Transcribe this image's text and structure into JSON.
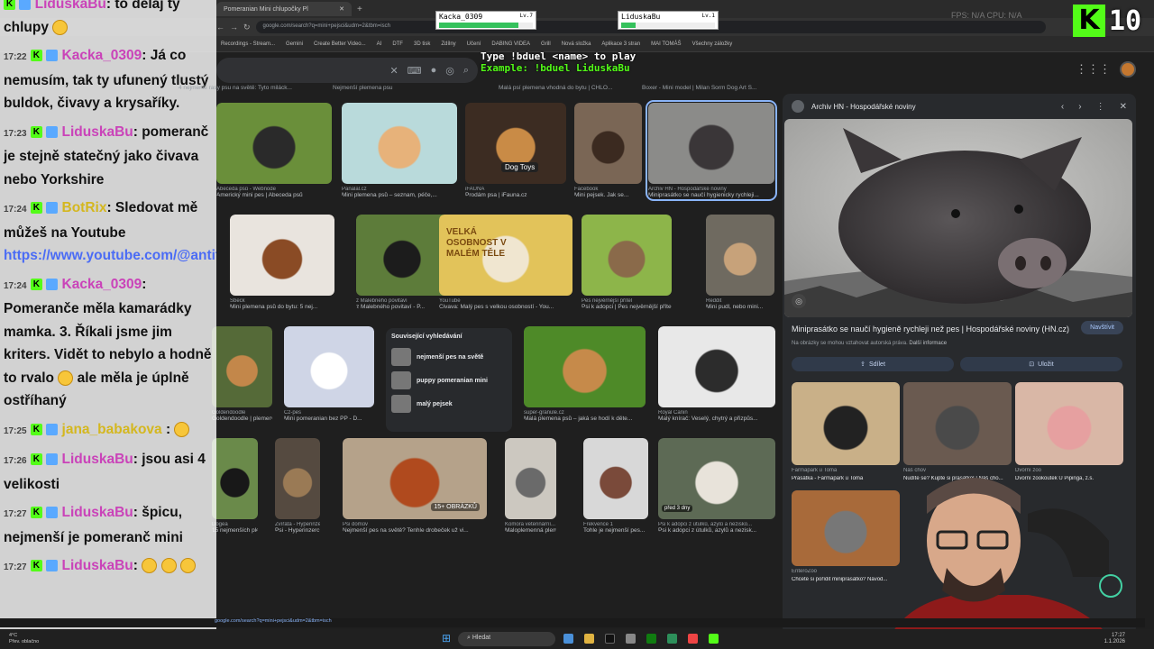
{
  "browser": {
    "tab_title": "Pomeranian Mini chlupočky Pl",
    "url": "google.com/search?q=mini+pejsci&udm=2&tbm=isch",
    "bookmarks": [
      "Recordings - Stream...",
      "Gemini",
      "Create Better Video...",
      "AI",
      "DTF",
      "3D tisk",
      "Zdílny",
      "Učení",
      "DABING VIDEA",
      "Grill",
      "Nová složka",
      "Aplikace 3 stran",
      "MAI TOMÁŠ",
      "Všechny záložky"
    ]
  },
  "images": [
    {
      "src": "Abeceda psů - Webnode",
      "cap": "Americký mini pes | Abeceda psů"
    },
    {
      "src": "Panalal.cz",
      "cap": "Mini plemena psů – seznam, péče,..."
    },
    {
      "src": "iFAUNA",
      "cap": "Prodám psa | iFauna.cz"
    },
    {
      "src": "Facebook",
      "cap": "Mini pejsek. Jak se..."
    },
    {
      "src": "Archiv HN - Hospodářské noviny",
      "cap": "Miniprasátko se naučí hygienicky rychleji..."
    },
    {
      "src": "Sbeck",
      "cap": "Mini plemena psů do bytu: 5 nej..."
    },
    {
      "src": "z Malebného povitaví",
      "cap": "z Malebného povitaví - P..."
    },
    {
      "src": "YouTube",
      "cap": "Čivava: Malý pes s velkou osobností - You..."
    },
    {
      "src": "Pes nejvěrnější přítel",
      "cap": "Psi k adopci | Pes nejvěrnější přítel"
    },
    {
      "src": "Reddit",
      "cap": "Mini pudl, nebo mini..."
    },
    {
      "src": "Cz-pes",
      "cap": "Mini pomeranian bez PP - D..."
    },
    {
      "src": "super-granule.cz",
      "cap": "Malá plemena psů – jaká se hodí k děte..."
    },
    {
      "src": "Royal Canin",
      "cap": "Malý knírač: Veselý, chytrý a přizpůs..."
    },
    {
      "src": "Zvířata - Hyperinzerce",
      "cap": "Psi - Hyperinzerce.cz"
    },
    {
      "src": "Psi domův",
      "cap": "Nejmenší pes na světě? Tenhle drobeček už vi..."
    },
    {
      "src": "Komora veterinární...",
      "cap": "Maloplemenná plem..."
    },
    {
      "src": "Frekvence 1",
      "cap": "Tohle je nejmenší pes..."
    },
    {
      "src": "Psi k adopci z útulků, azylů a nezisko...",
      "cap": "Psi k adopci z útulků, azylů a nezisk..."
    },
    {
      "src": "Dogea",
      "cap": "15 nejmenších plemen psov..."
    },
    {
      "src": "Goldendoodle",
      "cap": "Goldendoodle | plemena psů v magazín..."
    }
  ],
  "row_top_captions": [
    "4 nejmenší rasy psu na světě: Tyto miláck...",
    "Nejmenší plemena psu",
    "Malá psí plemena vhodná do bytu | CHLO...",
    "Boxer - Mini model | Milan Sorm Dog Art S..."
  ],
  "vintage_label": "VELKÁ OSOBNOST V MALÉM TĚLE",
  "badge_15": "15+ OBRÁZKŮ",
  "badge_dog_toys": "Dog Toys",
  "badge_3days": "před 3 dny",
  "related": {
    "title": "Související vyhledávání",
    "items": [
      "nejmenší pes na světě",
      "puppy pomeranian mini",
      "malý pejsek"
    ]
  },
  "panel": {
    "source": "Archiv HN - Hospodářské noviny",
    "title": "Miniprasátko se naučí hygienĕ rychleji než pes | Hospodářské noviny (HN.cz)",
    "visit": "Navštívit",
    "note": "Na obrázky se mohou vztahovat autorská práva.",
    "note_link": "Další informace",
    "share": "Sdílet",
    "save": "Uložit",
    "thumbs": [
      {
        "src": "Farmapark u Toma",
        "cap": "Prasátka - Farmapark u Toma"
      },
      {
        "src": "Náš chov",
        "cap": "Nudíte se? Kupte si prasátko! | Náš cho..."
      },
      {
        "src": "Dvorní zoo",
        "cap": "Dvorní zookoutek U Pipinga, z.s."
      },
      {
        "src": "EnteroZoo",
        "cap": "Chcete si pořídit miniprasátko? Návod..."
      }
    ]
  },
  "chat": [
    {
      "time": "",
      "user": "LiduskaBu",
      "color": "pink",
      "text": ": to dělaj ty chlupy",
      "emoji": true
    },
    {
      "time": "17:22",
      "user": "Kacka_0309",
      "color": "pink",
      "text": ": Já co nemusím, tak ty ufunený tlustý buldok, čivavy a krysaříky."
    },
    {
      "time": "17:23",
      "user": "LiduskaBu",
      "color": "pink",
      "text": ": pomeranč je stejně statečný jako čivava nebo Yorkshire"
    },
    {
      "time": "17:24",
      "user": "BotRix",
      "color": "yellow",
      "text": ": Sledovat mě můžeš na Youtube",
      "link": "https://www.youtube.com/@antitiktokercz"
    },
    {
      "time": "17:24",
      "user": "Kacka_0309",
      "color": "pink",
      "text": ": Pomeranče měla kamarádky mamka. 3. Říkali jsme jim kriters. Vidět to nebylo a hodně to rvalo",
      "text2": " ale měla je úplně ostříhaný",
      "emoji": true
    },
    {
      "time": "17:25",
      "user": "jana_babakova",
      "color": "yellow",
      "text": " :",
      "emoji_only": true
    },
    {
      "time": "17:26",
      "user": "LiduskaBu",
      "color": "pink",
      "text": ": jsou asi 4 velikosti"
    },
    {
      "time": "17:27",
      "user": "LiduskaBu",
      "color": "pink",
      "text": ": špicu, nejmenší je pomeranč mini"
    },
    {
      "time": "17:27",
      "user": "LiduskaBu",
      "color": "pink",
      "text": ":",
      "emoji_triple": true
    }
  ],
  "overlay": {
    "player1": "Kacka_0309",
    "player1_lv": "Lv.7",
    "player1_hp": 0.85,
    "player2": "LiduskaBu",
    "player2_lv": "Lv.1",
    "player2_hp": 0.15,
    "duel_line1": "Type !bduel <name> to play",
    "duel_line2": "Example: !bduel LiduskaBu",
    "kick_count": "10",
    "fps": "FPS: N/A   CPU: N/A"
  },
  "taskbar": {
    "search": "Hledat",
    "weather_temp": "4°C",
    "weather_text": "Přev. oblačno",
    "time": "17:27",
    "date": "1.1.2026"
  }
}
